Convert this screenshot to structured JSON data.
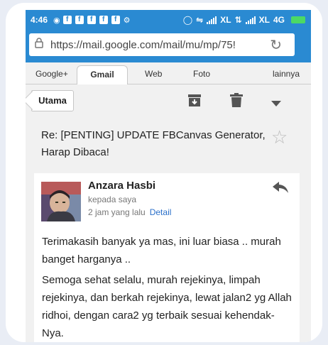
{
  "status": {
    "time": "4:46",
    "fb_icon": "f",
    "carrier1": "XL",
    "carrier2": "XL",
    "network": "4G"
  },
  "browser": {
    "url": "https://mail.google.com/mail/mu/mp/75!",
    "tabs": [
      "Google+",
      "Gmail",
      "Web",
      "Foto",
      "lainnya"
    ],
    "active_tab": "Gmail"
  },
  "toolbar": {
    "back_label": "Utama",
    "icons": [
      "archive-icon",
      "trash-icon",
      "dropdown-icon"
    ]
  },
  "email": {
    "subject": "Re: [PENTING] UPDATE FBCanvas Generator, Harap Dibaca!",
    "sender": "Anzara Hasbi",
    "recipient": "kepada saya",
    "time_ago": "2 jam yang lalu",
    "detail_link": "Detail",
    "paragraph1": "Terimakasih banyak ya mas, ini luar biasa .. murah banget harganya ..",
    "paragraph2": "Semoga sehat selalu, murah rejekinya, limpah rejekinya, dan berkah rejekinya, lewat jalan2 yg Allah ridhoi, dengan cara2 yg terbaik sesuai kehendak-Nya."
  },
  "colors": {
    "accent": "#2a8ad2",
    "link": "#2a6fc9",
    "battery": "#4cd964"
  }
}
